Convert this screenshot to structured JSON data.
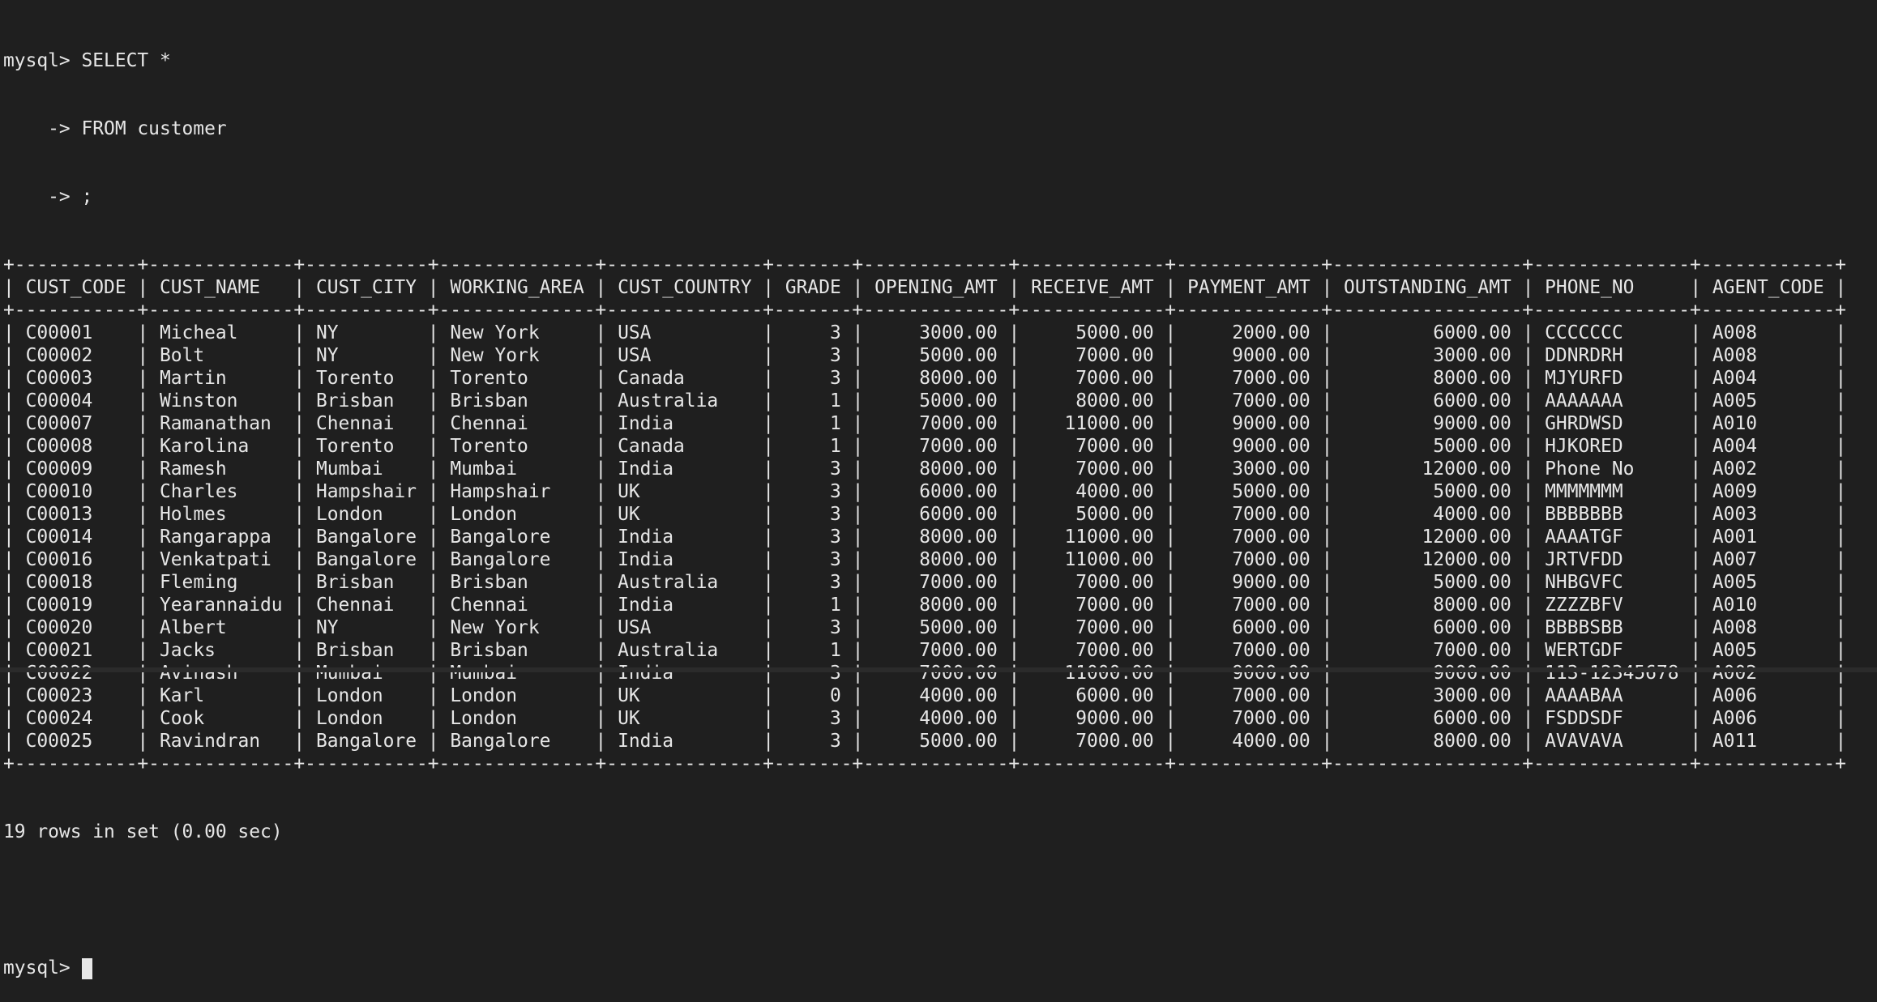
{
  "terminal": {
    "prompt": "mysql> ",
    "query_lines": [
      "SELECT *",
      "    -> FROM customer",
      "    -> ;"
    ],
    "result_footer": "19 rows in set (0.00 sec)"
  },
  "table": {
    "columns": [
      {
        "name": "CUST_CODE",
        "align": "left",
        "width": 9
      },
      {
        "name": "CUST_NAME",
        "align": "left",
        "width": 11
      },
      {
        "name": "CUST_CITY",
        "align": "left",
        "width": 9
      },
      {
        "name": "WORKING_AREA",
        "align": "left",
        "width": 12
      },
      {
        "name": "CUST_COUNTRY",
        "align": "left",
        "width": 12
      },
      {
        "name": "GRADE",
        "align": "right",
        "width": 5
      },
      {
        "name": "OPENING_AMT",
        "align": "right",
        "width": 11
      },
      {
        "name": "RECEIVE_AMT",
        "align": "right",
        "width": 11
      },
      {
        "name": "PAYMENT_AMT",
        "align": "right",
        "width": 11
      },
      {
        "name": "OUTSTANDING_AMT",
        "align": "right",
        "width": 15
      },
      {
        "name": "PHONE_NO",
        "align": "left",
        "width": 12
      },
      {
        "name": "AGENT_CODE",
        "align": "left",
        "width": 10
      }
    ],
    "rows": [
      [
        "C00001",
        "Micheal",
        "NY",
        "New York",
        "USA",
        "3",
        "3000.00",
        "5000.00",
        "2000.00",
        "6000.00",
        "CCCCCCC",
        "A008"
      ],
      [
        "C00002",
        "Bolt",
        "NY",
        "New York",
        "USA",
        "3",
        "5000.00",
        "7000.00",
        "9000.00",
        "3000.00",
        "DDNRDRH",
        "A008"
      ],
      [
        "C00003",
        "Martin",
        "Torento",
        "Torento",
        "Canada",
        "3",
        "8000.00",
        "7000.00",
        "7000.00",
        "8000.00",
        "MJYURFD",
        "A004"
      ],
      [
        "C00004",
        "Winston",
        "Brisban",
        "Brisban",
        "Australia",
        "1",
        "5000.00",
        "8000.00",
        "7000.00",
        "6000.00",
        "AAAAAAA",
        "A005"
      ],
      [
        "C00007",
        "Ramanathan",
        "Chennai",
        "Chennai",
        "India",
        "1",
        "7000.00",
        "11000.00",
        "9000.00",
        "9000.00",
        "GHRDWSD",
        "A010"
      ],
      [
        "C00008",
        "Karolina",
        "Torento",
        "Torento",
        "Canada",
        "1",
        "7000.00",
        "7000.00",
        "9000.00",
        "5000.00",
        "HJKORED",
        "A004"
      ],
      [
        "C00009",
        "Ramesh",
        "Mumbai",
        "Mumbai",
        "India",
        "3",
        "8000.00",
        "7000.00",
        "3000.00",
        "12000.00",
        "Phone No",
        "A002"
      ],
      [
        "C00010",
        "Charles",
        "Hampshair",
        "Hampshair",
        "UK",
        "3",
        "6000.00",
        "4000.00",
        "5000.00",
        "5000.00",
        "MMMMMMM",
        "A009"
      ],
      [
        "C00013",
        "Holmes",
        "London",
        "London",
        "UK",
        "3",
        "6000.00",
        "5000.00",
        "7000.00",
        "4000.00",
        "BBBBBBB",
        "A003"
      ],
      [
        "C00014",
        "Rangarappa",
        "Bangalore",
        "Bangalore",
        "India",
        "3",
        "8000.00",
        "11000.00",
        "7000.00",
        "12000.00",
        "AAAATGF",
        "A001"
      ],
      [
        "C00016",
        "Venkatpati",
        "Bangalore",
        "Bangalore",
        "India",
        "3",
        "8000.00",
        "11000.00",
        "7000.00",
        "12000.00",
        "JRTVFDD",
        "A007"
      ],
      [
        "C00018",
        "Fleming",
        "Brisban",
        "Brisban",
        "Australia",
        "3",
        "7000.00",
        "7000.00",
        "9000.00",
        "5000.00",
        "NHBGVFC",
        "A005"
      ],
      [
        "C00019",
        "Yearannaidu",
        "Chennai",
        "Chennai",
        "India",
        "1",
        "8000.00",
        "7000.00",
        "7000.00",
        "8000.00",
        "ZZZZBFV",
        "A010"
      ],
      [
        "C00020",
        "Albert",
        "NY",
        "New York",
        "USA",
        "3",
        "5000.00",
        "7000.00",
        "6000.00",
        "6000.00",
        "BBBBSBB",
        "A008"
      ],
      [
        "C00021",
        "Jacks",
        "Brisban",
        "Brisban",
        "Australia",
        "1",
        "7000.00",
        "7000.00",
        "7000.00",
        "7000.00",
        "WERTGDF",
        "A005"
      ],
      [
        "C00022",
        "Avinash",
        "Mumbai",
        "Mumbai",
        "India",
        "3",
        "7000.00",
        "11000.00",
        "9000.00",
        "9000.00",
        "113-12345678",
        "A002"
      ],
      [
        "C00023",
        "Karl",
        "London",
        "London",
        "UK",
        "0",
        "4000.00",
        "6000.00",
        "7000.00",
        "3000.00",
        "AAAABAA",
        "A006"
      ],
      [
        "C00024",
        "Cook",
        "London",
        "London",
        "UK",
        "3",
        "4000.00",
        "9000.00",
        "7000.00",
        "6000.00",
        "FSDDSDF",
        "A006"
      ],
      [
        "C00025",
        "Ravindran",
        "Bangalore",
        "Bangalore",
        "India",
        "3",
        "5000.00",
        "7000.00",
        "4000.00",
        "8000.00",
        "AVAVAVA",
        "A011"
      ]
    ]
  },
  "colors": {
    "background": "#1f1f1f",
    "text": "#e6e6e6",
    "cursor": "#e8e8e8"
  }
}
